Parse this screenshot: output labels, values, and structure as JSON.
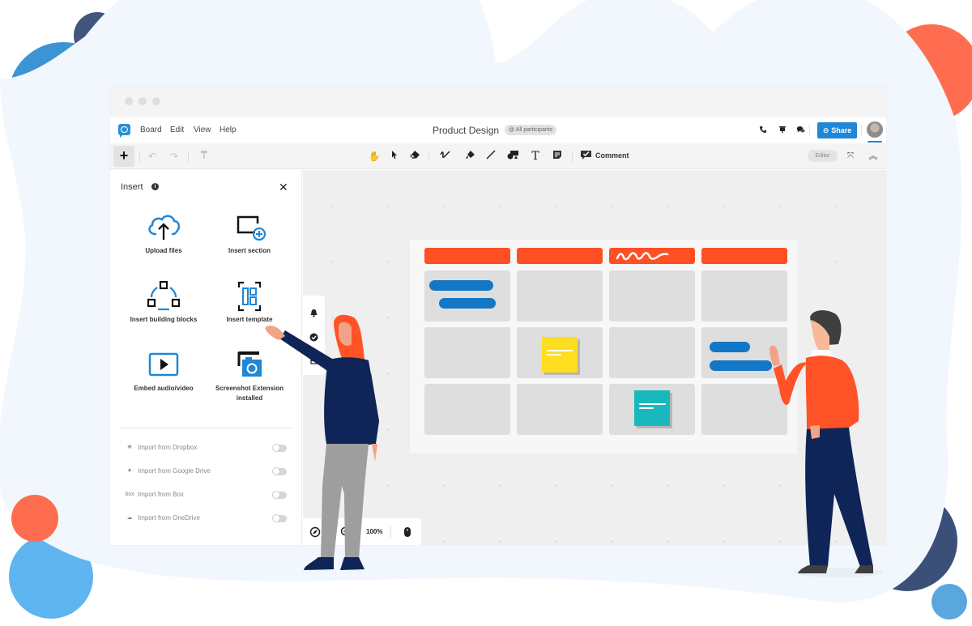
{
  "window": {
    "app_logo": "board-app-logo",
    "menu": [
      "Board",
      "Edit",
      "View",
      "Help"
    ],
    "board_title": "Product Design",
    "participants_badge": "@ All participants",
    "header_icons": [
      "phone-icon",
      "presentation-icon",
      "chat-icon"
    ],
    "share_label": "Share",
    "share_icon": "link-icon"
  },
  "toolbar": {
    "add_label": "+",
    "left_tools": [
      "undo-icon",
      "redo-icon",
      "paint-roller-icon"
    ],
    "center_tools": [
      "hand-icon",
      "pointer-icon",
      "eraser-icon",
      "pen-icon",
      "highlighter-icon",
      "line-icon",
      "shapes-icon",
      "text-icon",
      "sticky-note-icon"
    ],
    "comment_label": "Comment",
    "mode_badge": "Editor",
    "right_tools": [
      "fullscreen-icon",
      "collapse-icon"
    ]
  },
  "insert_panel": {
    "title": "Insert",
    "tiles": [
      {
        "label": "Upload files",
        "icon": "cloud-upload-icon"
      },
      {
        "label": "Insert section",
        "icon": "section-add-icon"
      },
      {
        "label": "Insert building blocks",
        "icon": "building-blocks-icon"
      },
      {
        "label": "Insert template",
        "icon": "template-icon"
      },
      {
        "label": "Embed audio/video",
        "icon": "play-video-icon"
      },
      {
        "label": "Screenshot Extension installed",
        "icon": "screenshot-camera-icon"
      }
    ],
    "imports": [
      {
        "label": "Import from Dropbox",
        "icon": "dropbox-icon",
        "enabled": false
      },
      {
        "label": "Import from Google Drive",
        "icon": "google-drive-icon",
        "enabled": false
      },
      {
        "label": "Import from Box",
        "icon": "box",
        "enabled": false
      },
      {
        "label": "Import from OneDrive",
        "icon": "onedrive-icon",
        "enabled": false
      }
    ]
  },
  "canvas": {
    "side_tools": [
      "bell-icon",
      "check-circle-icon",
      "list-icon"
    ],
    "bottom_tools": [
      "compass-icon",
      "zoom-in-icon",
      "mouse-icon"
    ],
    "zoom_level": "100%"
  },
  "colors": {
    "accent": "#1f87d6",
    "header_red": "#ff4f24",
    "blue_bar": "#1477c5",
    "sticky_yellow": "#ffde1f",
    "sticky_teal": "#19b8bd"
  }
}
